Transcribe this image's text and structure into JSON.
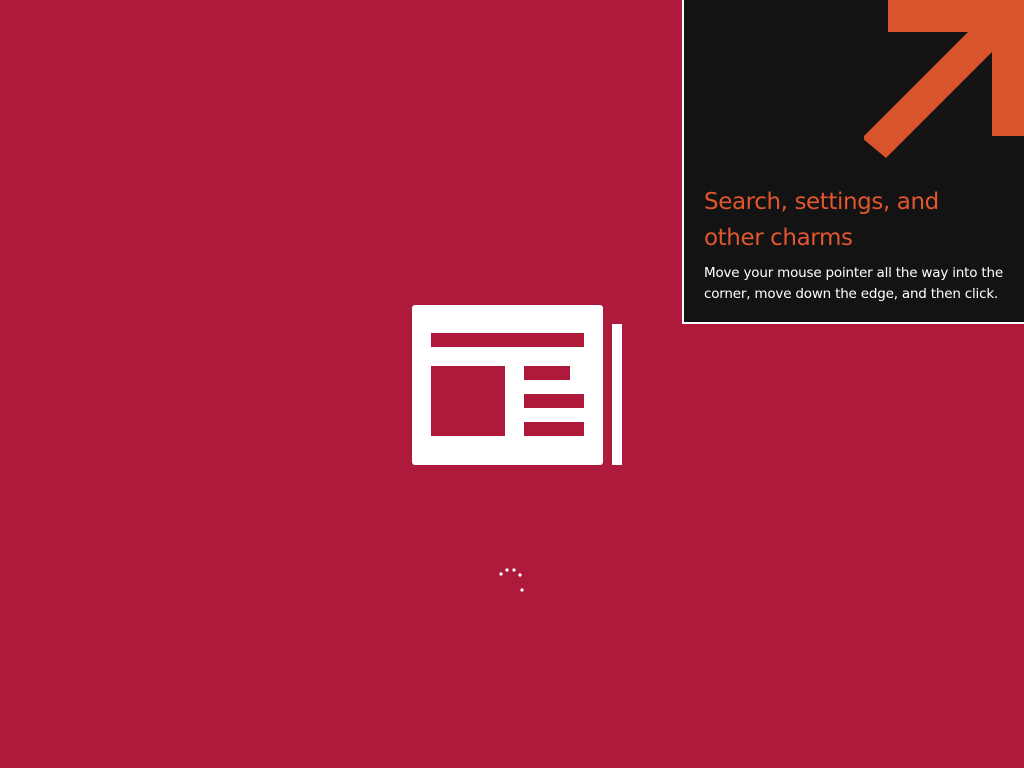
{
  "screen": {
    "background_color": "#AD1A3C",
    "state": "app-loading"
  },
  "app_logo": {
    "icon": "newspaper-icon",
    "color": "#ffffff"
  },
  "progress": {
    "icon": "loading-dots-icon",
    "indeterminate": true
  },
  "charms_tip": {
    "title": "Search, settings, and other charms",
    "body": "Move your mouse pointer all the way into the corner, move down the edge, and then click.",
    "arrow_icon": "diagonal-arrow-up-right-icon",
    "accent_color": "#D9532C",
    "background_color": "#131313"
  }
}
